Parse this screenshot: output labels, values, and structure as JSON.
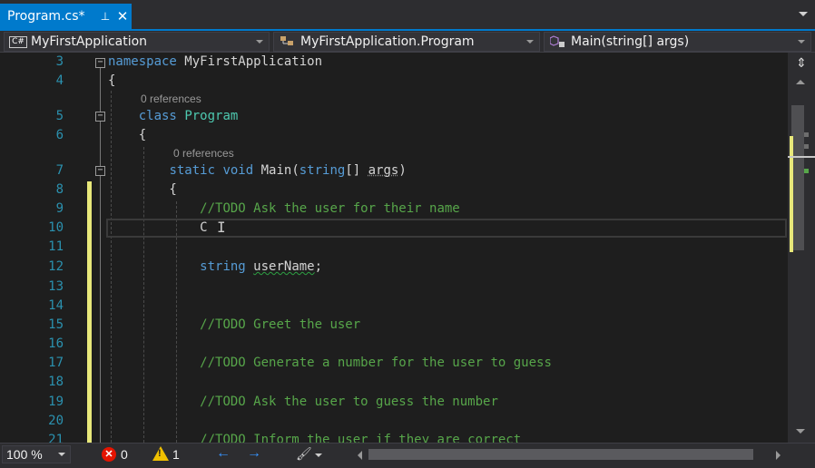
{
  "tab": {
    "title": "Program.cs*",
    "pin_glyph": "⊥",
    "close_glyph": "✕"
  },
  "navbar": {
    "project": "MyFirstApplication",
    "project_badge": "C#",
    "type": "MyFirstApplication.Program",
    "member": "Main(string[] args)"
  },
  "editor": {
    "codelens_class": "0 references",
    "codelens_main": "0 references",
    "lines": [
      {
        "num": "3",
        "tokens": [
          [
            "kw",
            "namespace"
          ],
          [
            "pl",
            " MyFirstApplication"
          ]
        ]
      },
      {
        "num": "4",
        "tokens": [
          [
            "pl",
            "{"
          ]
        ]
      },
      {
        "num": "5",
        "tokens": [
          [
            "pl",
            "    "
          ],
          [
            "kw",
            "class"
          ],
          [
            "pl",
            " "
          ],
          [
            "ty",
            "Program"
          ]
        ]
      },
      {
        "num": "6",
        "tokens": [
          [
            "pl",
            "    {"
          ]
        ]
      },
      {
        "num": "7",
        "tokens": [
          [
            "pl",
            "        "
          ],
          [
            "kw",
            "static"
          ],
          [
            "pl",
            " "
          ],
          [
            "kw",
            "void"
          ],
          [
            "pl",
            " Main("
          ],
          [
            "kw",
            "string"
          ],
          [
            "pl",
            "[] "
          ],
          [
            "pl",
            "args"
          ],
          [
            "pl",
            ")"
          ]
        ]
      },
      {
        "num": "8",
        "tokens": [
          [
            "pl",
            "        {"
          ]
        ]
      },
      {
        "num": "9",
        "tokens": [
          [
            "pl",
            "            "
          ],
          [
            "cm",
            "//TODO Ask the user for their name"
          ]
        ]
      },
      {
        "num": "10",
        "tokens": [
          [
            "pl",
            "            C"
          ]
        ]
      },
      {
        "num": "11",
        "tokens": []
      },
      {
        "num": "12",
        "tokens": [
          [
            "pl",
            "            "
          ],
          [
            "kw",
            "string"
          ],
          [
            "pl",
            " "
          ],
          [
            "pl",
            "userName"
          ],
          [
            "pl",
            ";"
          ]
        ]
      },
      {
        "num": "13",
        "tokens": []
      },
      {
        "num": "14",
        "tokens": []
      },
      {
        "num": "15",
        "tokens": [
          [
            "pl",
            "            "
          ],
          [
            "cm",
            "//TODO Greet the user"
          ]
        ]
      },
      {
        "num": "16",
        "tokens": []
      },
      {
        "num": "17",
        "tokens": [
          [
            "pl",
            "            "
          ],
          [
            "cm",
            "//TODO Generate a number for the user to guess"
          ]
        ]
      },
      {
        "num": "18",
        "tokens": []
      },
      {
        "num": "19",
        "tokens": [
          [
            "pl",
            "            "
          ],
          [
            "cm",
            "//TODO Ask the user to guess the number"
          ]
        ]
      },
      {
        "num": "20",
        "tokens": []
      },
      {
        "num": "21",
        "tokens": [
          [
            "pl",
            "            "
          ],
          [
            "cm",
            "//TODO Inform the user if they are correct"
          ]
        ]
      }
    ]
  },
  "status": {
    "zoom": "100 %",
    "errors": "0",
    "warnings": "1",
    "error_glyph": "✕",
    "warning_glyph": "!",
    "back_glyph": "←",
    "forward_glyph": "→",
    "brush_glyph": "🖌"
  },
  "icons": {
    "project": "csharp-project-icon",
    "type": "class-icon",
    "member": "method-icon",
    "split": "split-editor-icon"
  },
  "colors": {
    "accent": "#007acc",
    "keyword": "#569cd6",
    "type": "#4ec9b0",
    "comment": "#57a64a",
    "line_number": "#2b91af",
    "change_marker": "#e8e87a"
  }
}
